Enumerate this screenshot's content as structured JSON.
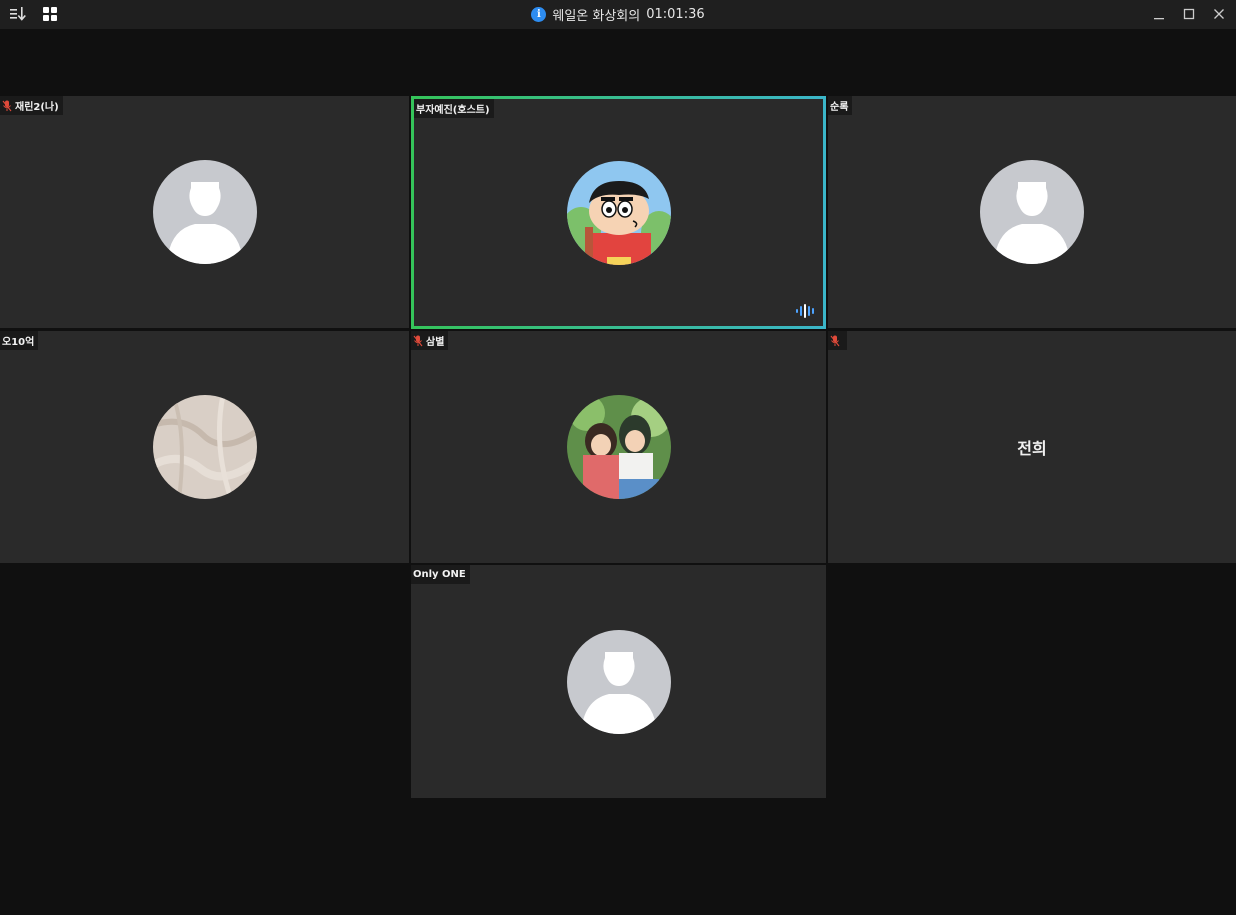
{
  "window": {
    "title": "웨일온 화상회의",
    "timer": "01:01:36"
  },
  "participants": [
    {
      "name": "재린2(나)",
      "muted": true,
      "avatar": "default-avatar"
    },
    {
      "name": "부자예진(호스트)",
      "muted": false,
      "speaking": true,
      "avatar": "cartoon-boy-avatar"
    },
    {
      "name": "순록",
      "muted": false,
      "avatar": "default-avatar"
    },
    {
      "name": "오10억",
      "muted": false,
      "avatar": "fabric-photo-avatar"
    },
    {
      "name": "삼별",
      "muted": true,
      "avatar": "anime-girls-avatar"
    },
    {
      "name": "",
      "center_label": "전희",
      "muted": true,
      "avatar": "none"
    },
    {
      "name": "Only ONE",
      "muted": false,
      "avatar": "default-avatar"
    }
  ],
  "icons": {
    "sort": "sort-icon",
    "grid": "grid-view-icon",
    "info": "info-icon",
    "minimize": "minimize-icon",
    "maximize": "maximize-icon",
    "close": "close-icon",
    "mic_off": "mic-off-icon",
    "audio": "audio-level-icon"
  },
  "colors": {
    "speaking_border_start": "#35c45a",
    "speaking_border_end": "#3bb6c9",
    "mic_off": "#e04a3a",
    "info": "#2d8cf0",
    "audio": "#4da3ff"
  }
}
